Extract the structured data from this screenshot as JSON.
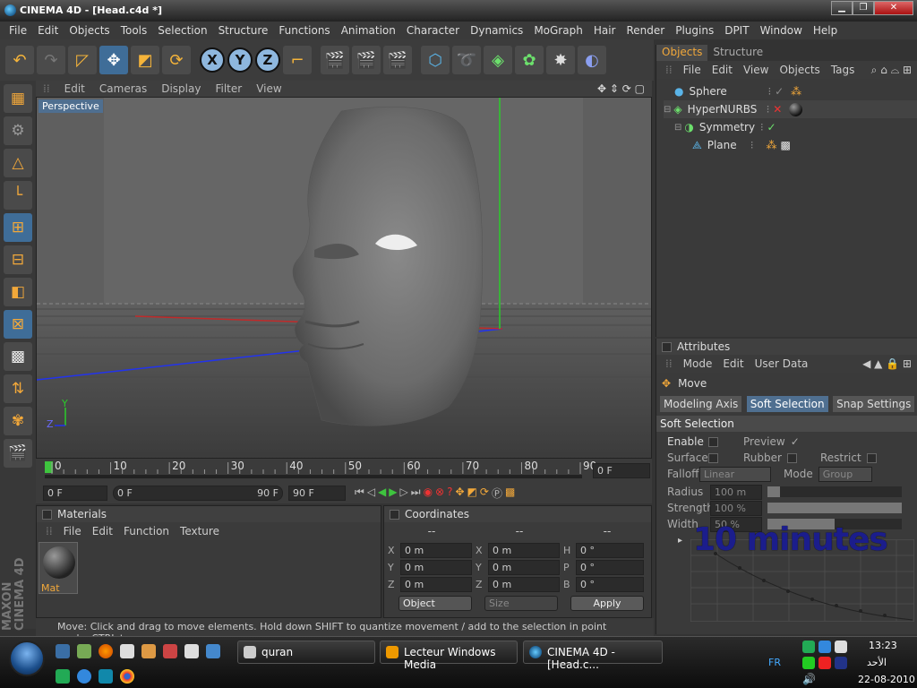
{
  "window": {
    "title": "CINEMA 4D - [Head.c4d *]",
    "min": "▁",
    "max": "❐",
    "close": "✕"
  },
  "menu": [
    "File",
    "Edit",
    "Objects",
    "Tools",
    "Selection",
    "Structure",
    "Functions",
    "Animation",
    "Character",
    "Dynamics",
    "MoGraph",
    "Hair",
    "Render",
    "Plugins",
    "DPIT",
    "Window",
    "Help"
  ],
  "toolbar": {
    "x": "X",
    "y": "Y",
    "z": "Z"
  },
  "viewport": {
    "menu": [
      "Edit",
      "Cameras",
      "Display",
      "Filter",
      "View"
    ],
    "label": "Perspective",
    "axis_y": "Y",
    "axis_z": "Z"
  },
  "timeline": {
    "ticks": [
      "0",
      "10",
      "20",
      "30",
      "40",
      "50",
      "60",
      "70",
      "80",
      "90"
    ],
    "current": "0 F"
  },
  "playbar": {
    "start": "0 F",
    "range_start": "0 F",
    "range_end": "90 F",
    "end": "90 F"
  },
  "materials": {
    "title": "Materials",
    "menu": [
      "File",
      "Edit",
      "Function",
      "Texture"
    ],
    "mat_name": "Mat"
  },
  "coords": {
    "title": "Coordinates",
    "dash1": "--",
    "dash2": "--",
    "dash3": "--",
    "rows": [
      {
        "a": "X",
        "av": "0 m",
        "b": "X",
        "bv": "0 m",
        "c": "H",
        "cv": "0 °"
      },
      {
        "a": "Y",
        "av": "0 m",
        "b": "Y",
        "bv": "0 m",
        "c": "P",
        "cv": "0 °"
      },
      {
        "a": "Z",
        "av": "0 m",
        "b": "Z",
        "bv": "0 m",
        "c": "B",
        "cv": "0 °"
      }
    ],
    "mode": "Object",
    "size": "Size",
    "apply": "Apply"
  },
  "status": "Move: Click and drag to move elements. Hold down SHIFT to quantize movement / add to the selection in point mode, CTRL to remove.",
  "objects": {
    "tabs": [
      "Objects",
      "Structure"
    ],
    "menu": [
      "File",
      "Edit",
      "View",
      "Objects",
      "Tags"
    ],
    "items": [
      "Sphere",
      "HyperNURBS",
      "Symmetry",
      "Plane"
    ]
  },
  "attributes": {
    "title": "Attributes",
    "menu": [
      "Mode",
      "Edit",
      "User Data"
    ],
    "tool": "Move",
    "tabs": [
      "Modeling Axis",
      "Soft Selection",
      "Snap Settings"
    ],
    "section": "Soft Selection",
    "enable": "Enable",
    "preview": "Preview",
    "surface": "Surface",
    "rubber": "Rubber",
    "restrict": "Restrict",
    "falloff": "Falloff",
    "falloff_val": "Linear",
    "mode": "Mode",
    "mode_val": "Group",
    "radius": "Radius",
    "radius_val": "100 m",
    "strength": "Strength",
    "strength_val": "100 %",
    "width": "Width",
    "width_val": "50 %"
  },
  "overlay": "10 minutes",
  "taskbar": {
    "tasks": [
      "quran",
      "Lecteur Windows Media",
      "CINEMA 4D - [Head.c..."
    ],
    "lang": "FR",
    "time": "13:23",
    "day": "الأحد",
    "date": "22-08-2010"
  },
  "colors": {
    "accent": "#f2a83a",
    "select": "#3f6d98"
  }
}
